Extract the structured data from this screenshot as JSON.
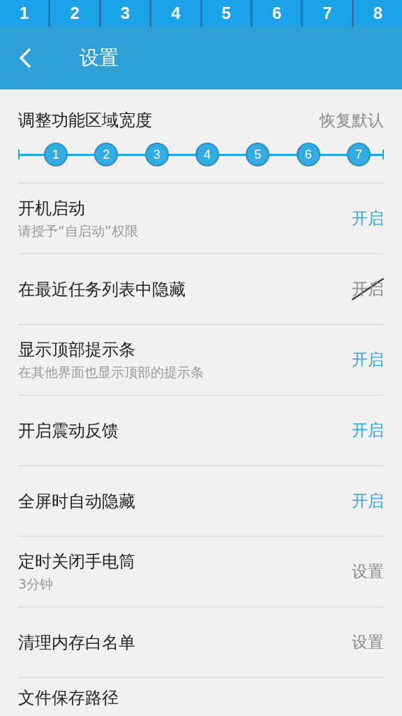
{
  "status_segments": [
    "1",
    "2",
    "3",
    "4",
    "5",
    "6",
    "7",
    "8"
  ],
  "header": {
    "title": "设置"
  },
  "width_section": {
    "title": "调整功能区域宽度",
    "reset": "恢复默认",
    "steps": [
      "1",
      "2",
      "3",
      "4",
      "5",
      "6",
      "7"
    ]
  },
  "settings": [
    {
      "kind": "toggle",
      "title": "开机启动",
      "subtitle": "请授予“自启动”权限",
      "action": "开启",
      "on": true
    },
    {
      "kind": "toggle",
      "title": "在最近任务列表中隐藏",
      "action": "开启",
      "on": false
    },
    {
      "kind": "toggle",
      "title": "显示顶部提示条",
      "subtitle": "在其他界面也显示顶部的提示条",
      "action": "开启",
      "on": true
    },
    {
      "kind": "toggle",
      "title": "开启震动反馈",
      "action": "开启",
      "on": true
    },
    {
      "kind": "toggle",
      "title": "全屏时自动隐藏",
      "action": "开启",
      "on": true
    },
    {
      "kind": "setting",
      "title": "定时关闭手电筒",
      "subtitle": "3分钟",
      "action": "设置"
    },
    {
      "kind": "setting",
      "title": "清理内存白名单",
      "action": "设置"
    },
    {
      "title": "文件保存路径"
    }
  ]
}
